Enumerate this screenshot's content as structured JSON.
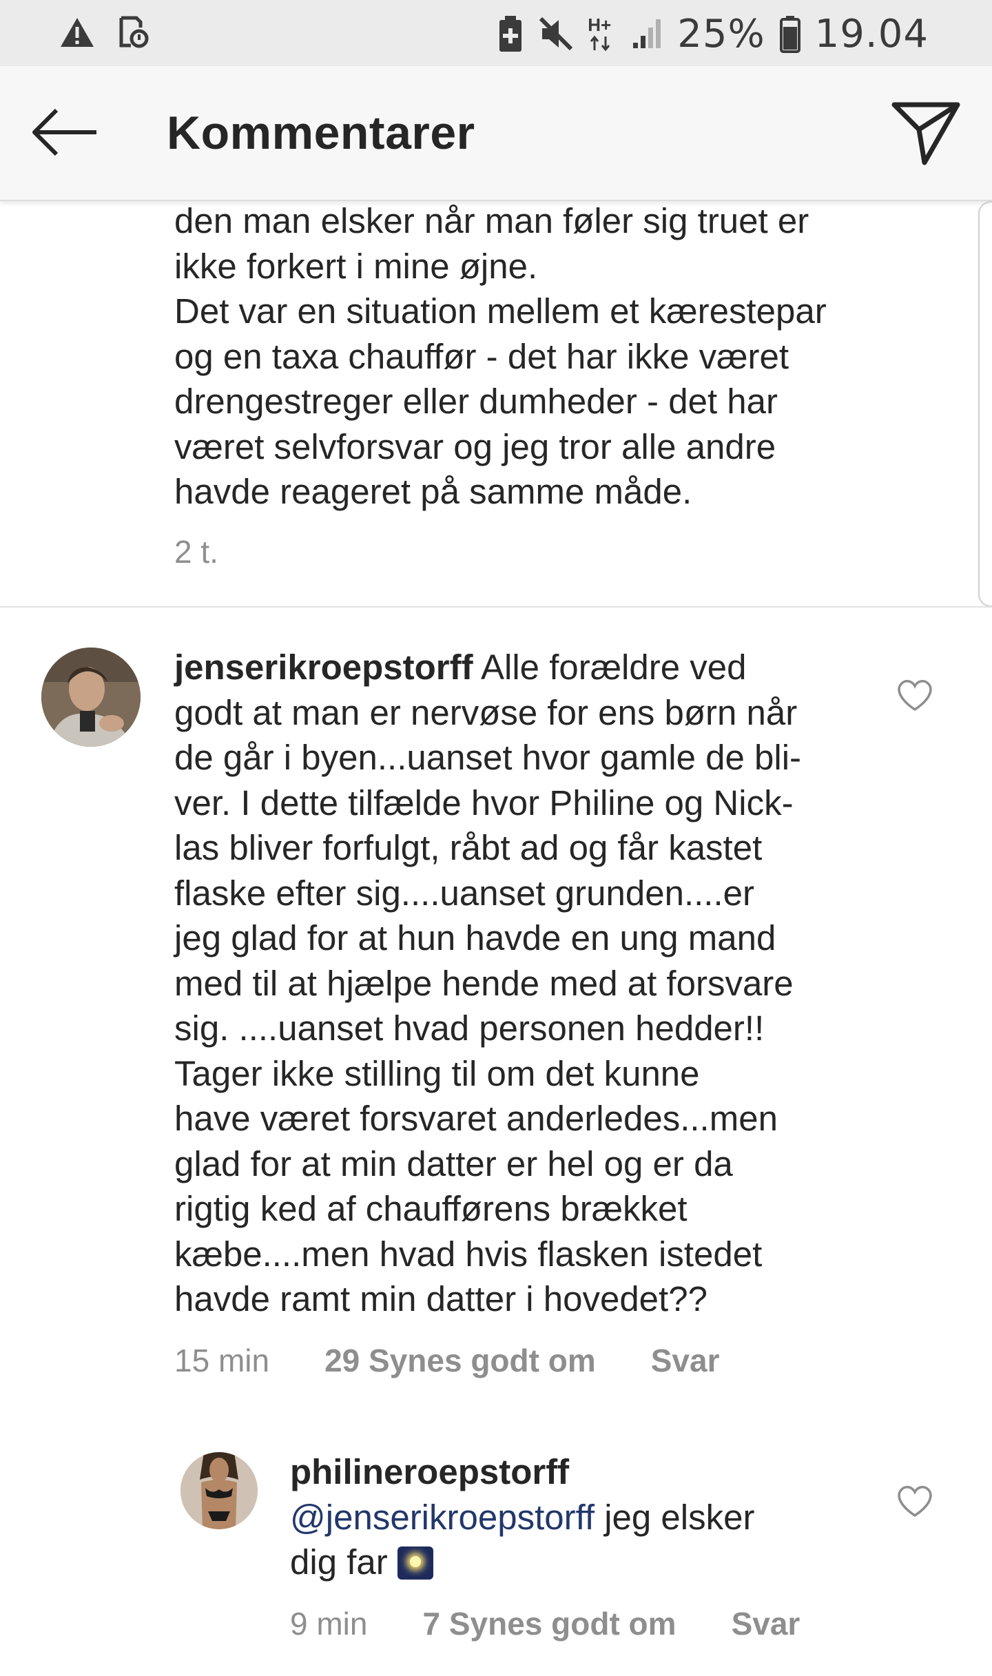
{
  "status_bar": {
    "battery_percent": "25%",
    "time": "19.04",
    "network": "H+"
  },
  "header": {
    "title": "Kommentarer"
  },
  "caption": {
    "lines": [
      "den man elsker når man føler sig truet er",
      "ikke forkert i mine øjne.",
      "Det var en situation mellem et kærestepar",
      "og en taxa chauffør - det har ikke været",
      "drengestreger eller dumheder - det har",
      "været selvforsvar og jeg tror alle andre",
      "havde reageret på samme måde."
    ],
    "time": "2 t."
  },
  "comments": [
    {
      "username": "jenserikroepstorff",
      "first_line_text": " Alle forældre ved",
      "lines": [
        "godt at man er nervøse for ens børn når",
        "de går i byen...uanset hvor gamle de bli-",
        "ver. I dette tilfælde hvor Philine og Nick-",
        "las bliver forfulgt, råbt ad og får kastet",
        "flaske efter sig....uanset grunden....er",
        "jeg glad for at hun havde en ung mand",
        "med til at hjælpe hende med at forsvare",
        "sig. ....uanset hvad personen hedder!!",
        "Tager ikke stilling til om det kunne",
        "have været forsvaret anderledes...men",
        "glad for at min datter er hel og er da",
        "rigtig ked af chaufførens brækket",
        "kæbe....men hvad hvis flasken istedet",
        "havde ramt min datter i hovedet??"
      ],
      "time": "15 min",
      "likes": "29 Synes godt om",
      "reply_label": "Svar"
    },
    {
      "username": "philineroepstorff",
      "mention": "@jenserikroepstorff",
      "text_after_mention": " jeg elsker",
      "second_line": "dig far",
      "time": "9 min",
      "likes": "7 Synes godt om",
      "reply_label": "Svar"
    }
  ],
  "colors": {
    "status_bar_bg": "#ebebeb",
    "header_bg": "#f7f7f7",
    "text": "#262626",
    "meta": "#8e8e8e",
    "mention": "#22376b"
  }
}
